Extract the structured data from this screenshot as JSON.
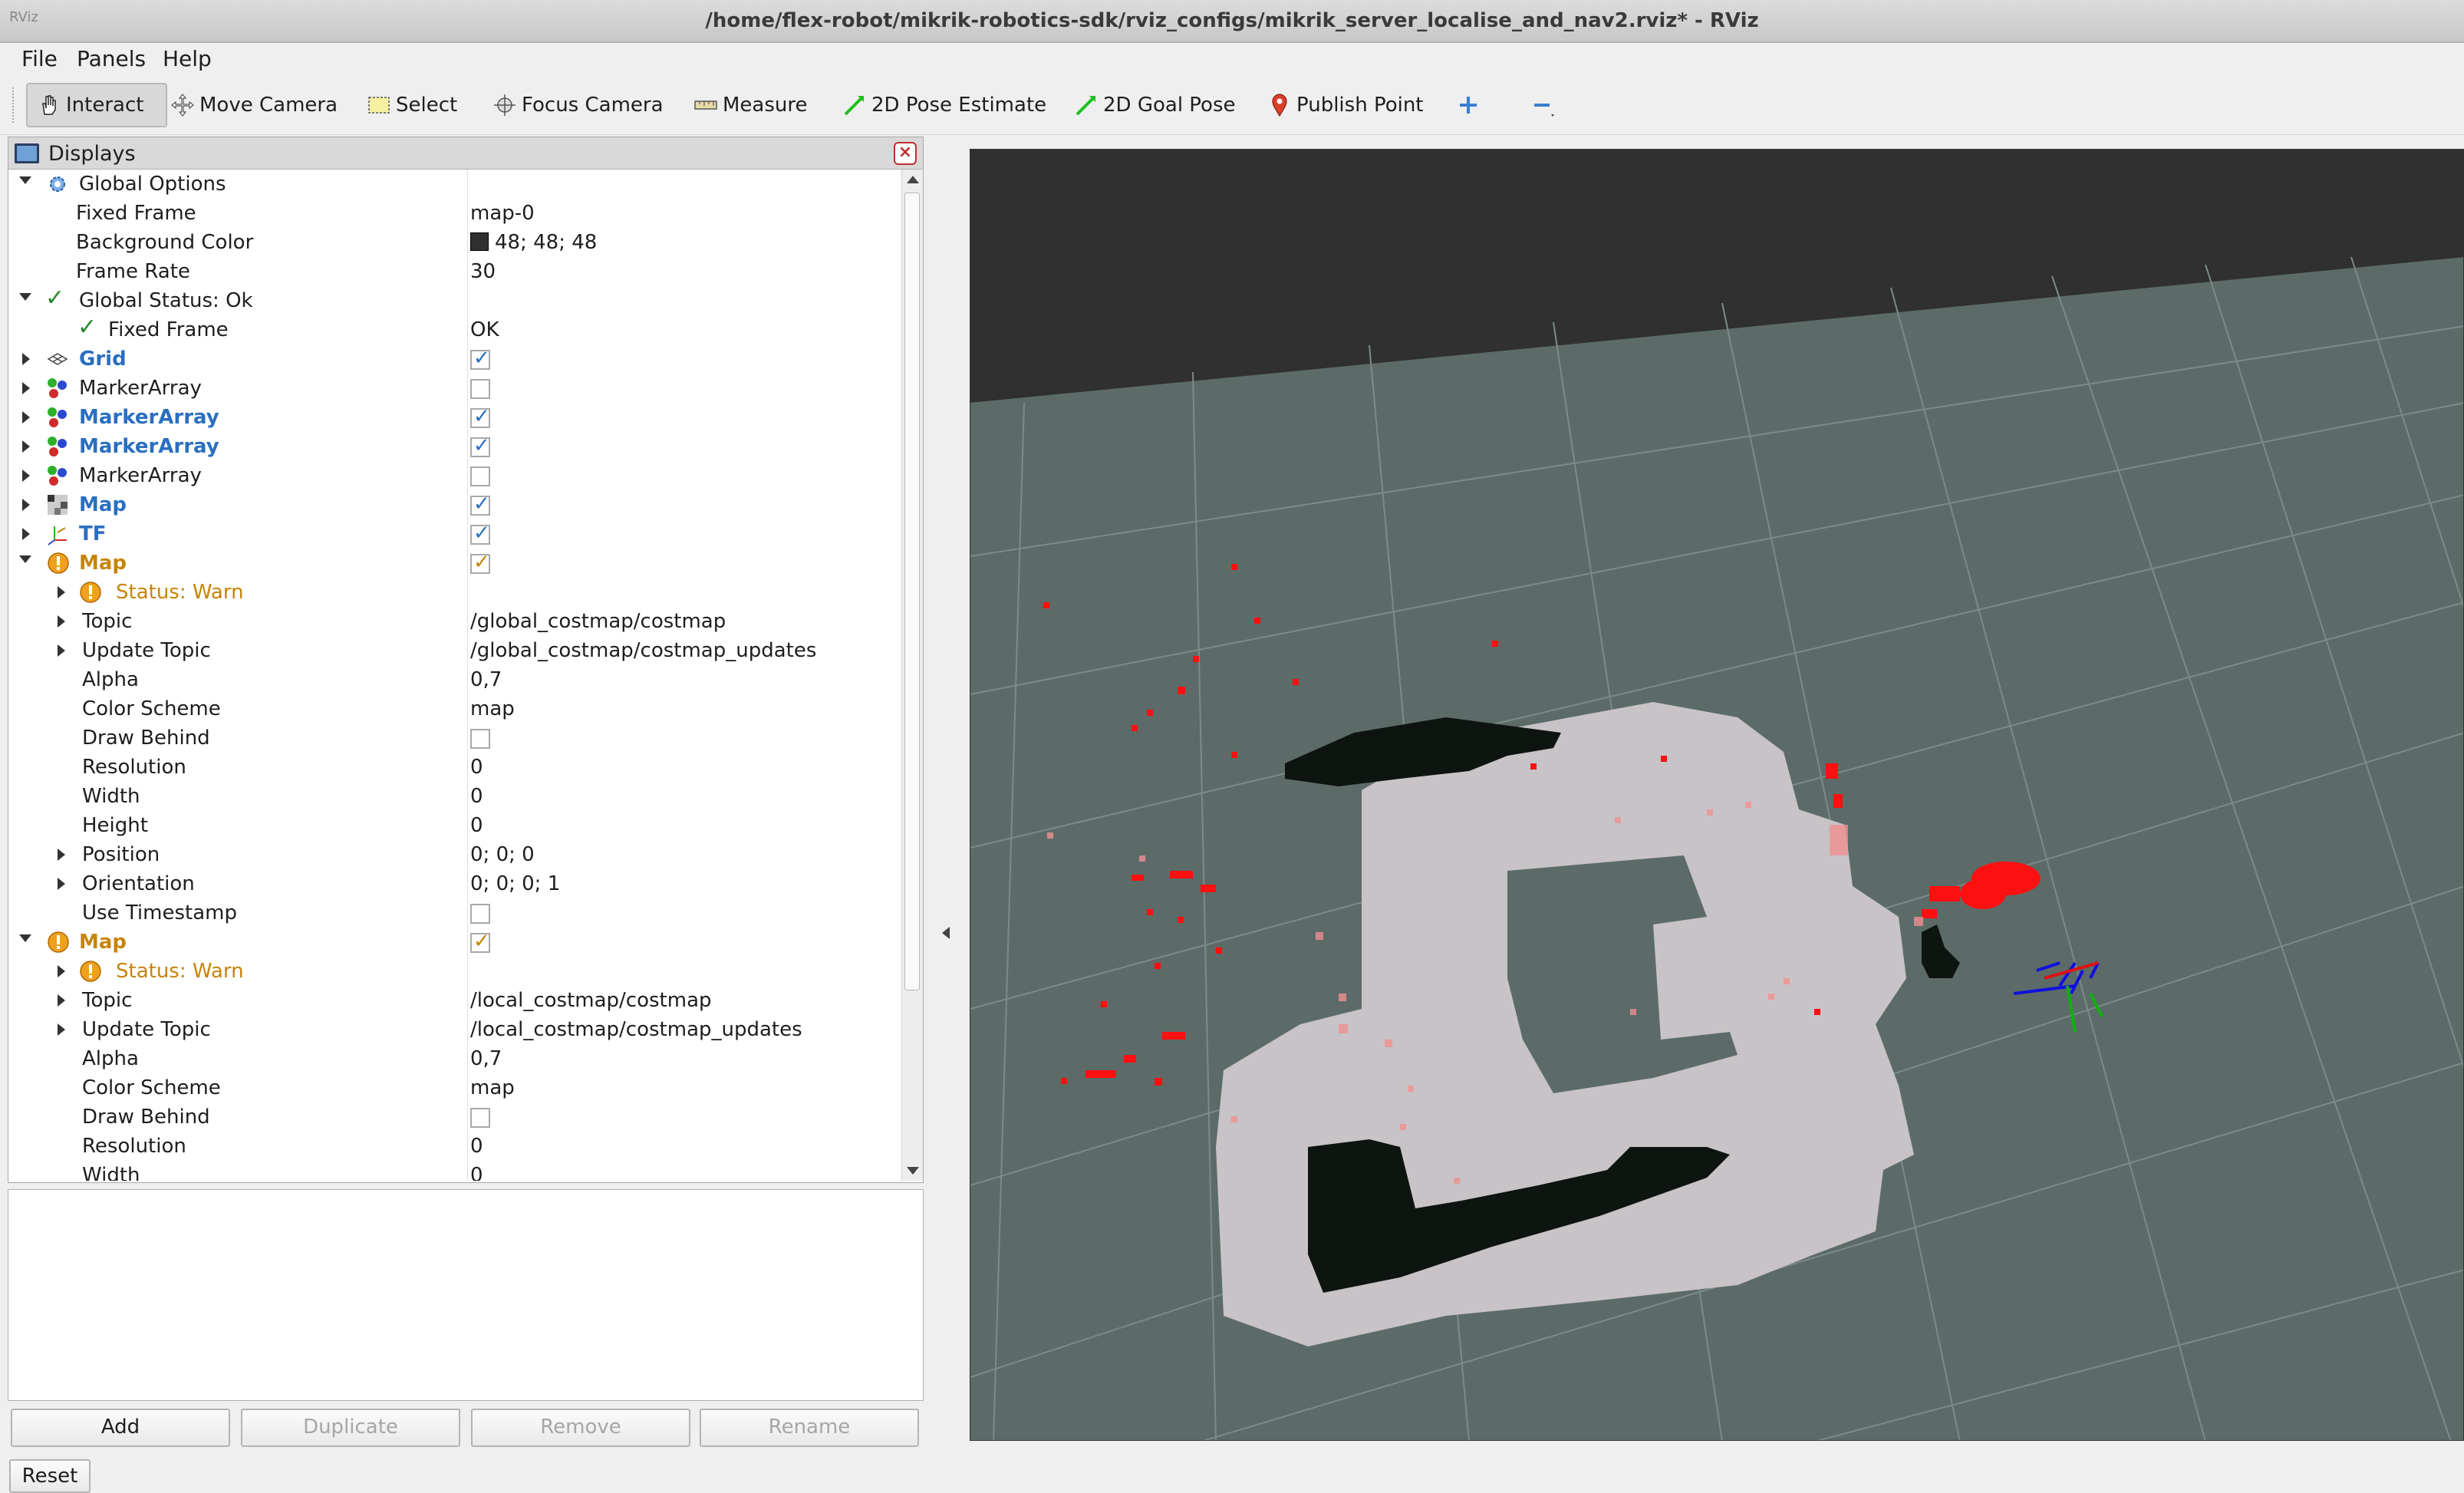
{
  "window": {
    "title": "/home/flex-robot/mikrik-robotics-sdk/rviz_configs/mikrik_server_localise_and_nav2.rviz* - RViz",
    "app_icon_text": "RViz"
  },
  "menu": [
    "File",
    "Panels",
    "Help"
  ],
  "toolbar": {
    "interact": "Interact",
    "move_camera": "Move Camera",
    "select": "Select",
    "focus_camera": "Focus Camera",
    "measure": "Measure",
    "pose_estimate": "2D Pose Estimate",
    "goal_pose": "2D Goal Pose",
    "publish_point": "Publish Point",
    "add_tool_icon": "plus-icon",
    "remove_tool_icon": "minus-icon"
  },
  "displays": {
    "title": "Displays",
    "rows": [
      {
        "name": "Global Options",
        "value": ""
      },
      {
        "name": "Fixed Frame",
        "value": "map-0"
      },
      {
        "name": "Background Color",
        "value": "48; 48; 48"
      },
      {
        "name": "Frame Rate",
        "value": "30"
      },
      {
        "name": "Global Status: Ok",
        "value": ""
      },
      {
        "name": "Fixed Frame",
        "value": "OK"
      },
      {
        "name": "Grid",
        "value": ""
      },
      {
        "name": "MarkerArray",
        "value": ""
      },
      {
        "name": "MarkerArray",
        "value": ""
      },
      {
        "name": "MarkerArray",
        "value": ""
      },
      {
        "name": "MarkerArray",
        "value": ""
      },
      {
        "name": "Map",
        "value": ""
      },
      {
        "name": "TF",
        "value": ""
      },
      {
        "name": "Map",
        "value": ""
      },
      {
        "name": "Status: Warn",
        "value": ""
      },
      {
        "name": "Topic",
        "value": "/global_costmap/costmap"
      },
      {
        "name": "Update Topic",
        "value": "/global_costmap/costmap_updates"
      },
      {
        "name": "Alpha",
        "value": "0,7"
      },
      {
        "name": "Color Scheme",
        "value": "map"
      },
      {
        "name": "Draw Behind",
        "value": ""
      },
      {
        "name": "Resolution",
        "value": "0"
      },
      {
        "name": "Width",
        "value": "0"
      },
      {
        "name": "Height",
        "value": "0"
      },
      {
        "name": "Position",
        "value": "0; 0; 0"
      },
      {
        "name": "Orientation",
        "value": "0; 0; 0; 1"
      },
      {
        "name": "Use Timestamp",
        "value": ""
      },
      {
        "name": "Map",
        "value": ""
      },
      {
        "name": "Status: Warn",
        "value": ""
      },
      {
        "name": "Topic",
        "value": "/local_costmap/costmap"
      },
      {
        "name": "Update Topic",
        "value": "/local_costmap/costmap_updates"
      },
      {
        "name": "Alpha",
        "value": "0,7"
      },
      {
        "name": "Color Scheme",
        "value": "map"
      },
      {
        "name": "Draw Behind",
        "value": ""
      },
      {
        "name": "Resolution",
        "value": "0"
      },
      {
        "name": "Width",
        "value": "0"
      }
    ],
    "checkboxes": {
      "grid": true,
      "marker1": false,
      "marker2": true,
      "marker3": true,
      "marker4": false,
      "map1": true,
      "tf": true,
      "map2": true,
      "map2_draw_behind": false,
      "map2_use_timestamp": false,
      "map3": true,
      "map3_draw_behind": false
    }
  },
  "buttons": {
    "add": "Add",
    "duplicate": "Duplicate",
    "remove": "Remove",
    "rename": "Rename",
    "reset": "Reset"
  },
  "colors": {
    "background": "#303030",
    "accent_blue": "#2a6fc0",
    "warn": "#c7840a",
    "ok": "#2a8a2a"
  }
}
